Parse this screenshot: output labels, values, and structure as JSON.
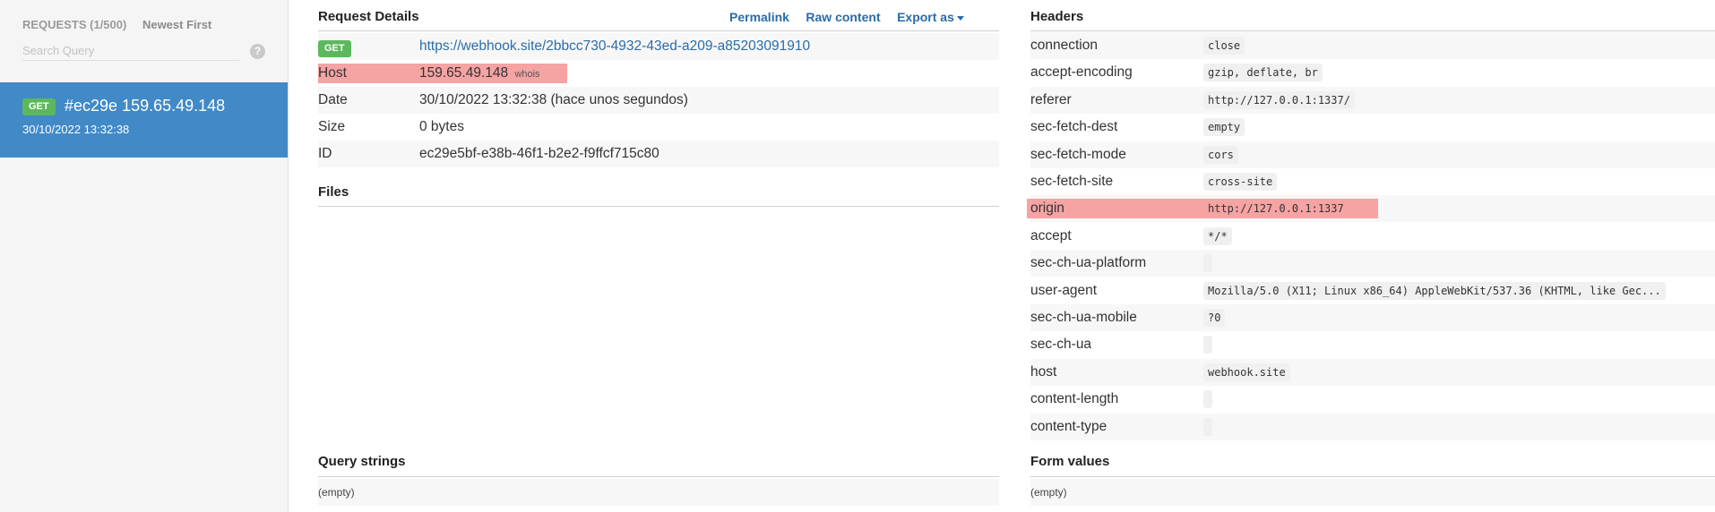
{
  "sidebar": {
    "requests_label": "REQUESTS (1/500)",
    "sort_label": "Newest First",
    "search_placeholder": "Search Query",
    "help_icon": "?",
    "selected_request": {
      "method": "GET",
      "title": "#ec29e 159.65.49.148",
      "date": "30/10/2022 13:32:38"
    }
  },
  "details": {
    "title": "Request Details",
    "actions": {
      "permalink": "Permalink",
      "raw": "Raw content",
      "export": "Export as"
    },
    "method": "GET",
    "url": "https://webhook.site/2bbcc730-4932-43ed-a209-a85203091910",
    "rows": [
      {
        "key": "Host",
        "value": "159.65.49.148",
        "extra": "whois"
      },
      {
        "key": "Date",
        "value": "30/10/2022 13:32:38 (hace unos segundos)"
      },
      {
        "key": "Size",
        "value": "0 bytes"
      },
      {
        "key": "ID",
        "value": "ec29e5bf-e38b-46f1-b2e2-f9ffcf715c80"
      }
    ]
  },
  "files": {
    "title": "Files"
  },
  "query_strings": {
    "title": "Query strings",
    "empty": "(empty)"
  },
  "headers": {
    "title": "Headers",
    "rows": [
      {
        "key": "connection",
        "value": "close"
      },
      {
        "key": "accept-encoding",
        "value": "gzip, deflate, br"
      },
      {
        "key": "referer",
        "value": "http://127.0.0.1:1337/"
      },
      {
        "key": "sec-fetch-dest",
        "value": "empty"
      },
      {
        "key": "sec-fetch-mode",
        "value": "cors"
      },
      {
        "key": "sec-fetch-site",
        "value": "cross-site"
      },
      {
        "key": "origin",
        "value": "http://127.0.0.1:1337"
      },
      {
        "key": "accept",
        "value": "*/*"
      },
      {
        "key": "sec-ch-ua-platform",
        "value": ""
      },
      {
        "key": "user-agent",
        "value": "Mozilla/5.0 (X11; Linux x86_64) AppleWebKit/537.36 (KHTML, like Gec..."
      },
      {
        "key": "sec-ch-ua-mobile",
        "value": "?0"
      },
      {
        "key": "sec-ch-ua",
        "value": ""
      },
      {
        "key": "host",
        "value": "webhook.site"
      },
      {
        "key": "content-length",
        "value": ""
      },
      {
        "key": "content-type",
        "value": ""
      }
    ]
  },
  "form_values": {
    "title": "Form values",
    "empty": "(empty)"
  },
  "colors": {
    "accent": "#4189c7",
    "link": "#2a6ca8",
    "badge": "#5cb85c",
    "highlight": "#f5a3a3"
  }
}
